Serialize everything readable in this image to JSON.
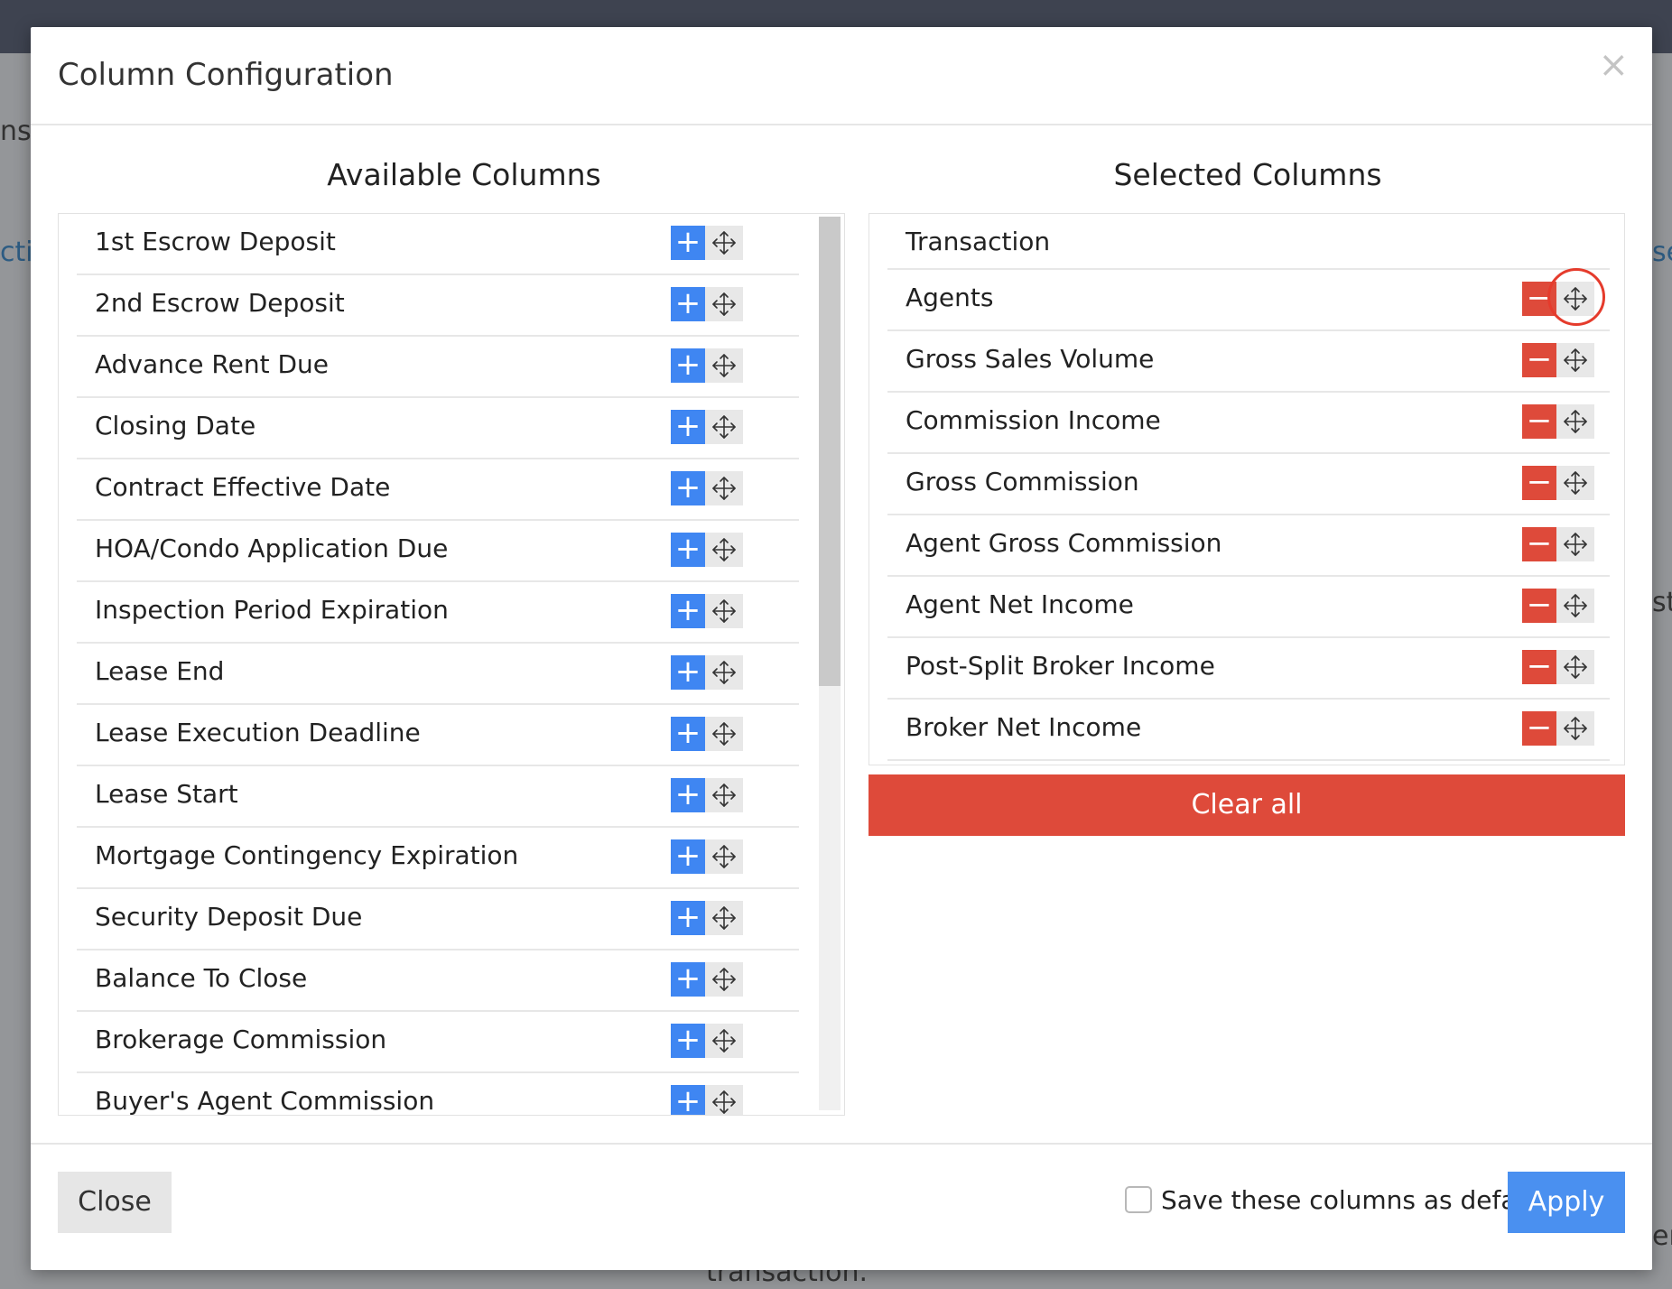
{
  "background": {
    "fragments": [
      "ns",
      "ctio",
      "se",
      "st",
      "er",
      "transaction."
    ]
  },
  "modal": {
    "title": "Column Configuration",
    "close_glyph": "×"
  },
  "available": {
    "title": "Available Columns",
    "add_glyph": "+",
    "items": [
      "1st Escrow Deposit",
      "2nd Escrow Deposit",
      "Advance Rent Due",
      "Closing Date",
      "Contract Effective Date",
      "HOA/Condo Application Due",
      "Inspection Period Expiration",
      "Lease End",
      "Lease Execution Deadline",
      "Lease Start",
      "Mortgage Contingency Expiration",
      "Security Deposit Due",
      "Balance To Close",
      "Brokerage Commission",
      "Buyer's Agent Commission"
    ]
  },
  "selected": {
    "title": "Selected Columns",
    "remove_glyph": "−",
    "fixed_item": "Transaction",
    "items": [
      "Agents",
      "Gross Sales Volume",
      "Commission Income",
      "Gross Commission",
      "Agent Gross Commission",
      "Agent Net Income",
      "Post-Split Broker Income",
      "Broker Net Income"
    ],
    "clear_label": "Clear all"
  },
  "footer": {
    "close_label": "Close",
    "save_default_label": "Save these columns as default?",
    "save_default_checked": false,
    "apply_label": "Apply"
  },
  "colors": {
    "add": "#3f86f2",
    "remove": "#de4a3a",
    "apply": "#4a90f0",
    "highlight": "#e53b2c"
  }
}
